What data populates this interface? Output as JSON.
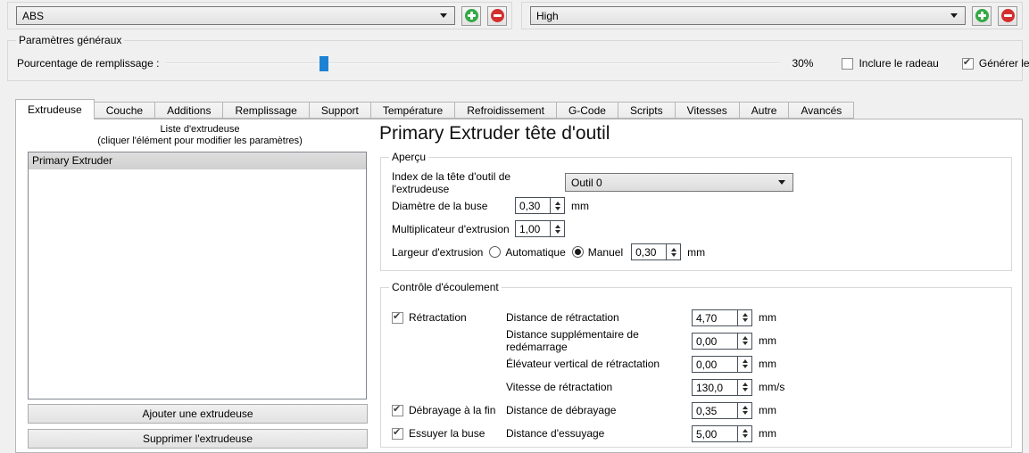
{
  "colors": {
    "window_background": "#f0f0f0",
    "slider_thumb_blue": "#1e82d2",
    "add_green": "#35a945",
    "remove_red": "#d32f2f"
  },
  "profiles": {
    "material_value": "ABS",
    "quality_value": "High"
  },
  "general": {
    "title": "Paramètres généraux",
    "infill_label": "Pourcentage de remplissage :",
    "infill_value": "30%",
    "infill_percent": 30,
    "raft_label": "Inclure le radeau",
    "raft_checked": false,
    "support_label": "Générer le support",
    "support_checked": true
  },
  "tabs": [
    {
      "label": "Extrudeuse",
      "active": true
    },
    {
      "label": "Couche",
      "active": false
    },
    {
      "label": "Additions",
      "active": false
    },
    {
      "label": "Remplissage",
      "active": false
    },
    {
      "label": "Support",
      "active": false
    },
    {
      "label": "Température",
      "active": false
    },
    {
      "label": "Refroidissement",
      "active": false
    },
    {
      "label": "G-Code",
      "active": false
    },
    {
      "label": "Scripts",
      "active": false
    },
    {
      "label": "Vitesses",
      "active": false
    },
    {
      "label": "Autre",
      "active": false
    },
    {
      "label": "Avancés",
      "active": false
    }
  ],
  "extruder_list": {
    "title": "Liste d'extrudeuse",
    "subtitle": "(cliquer l'élément pour modifier les paramètres)",
    "items": [
      {
        "label": "Primary Extruder",
        "selected": true
      }
    ],
    "add_button": "Ajouter une extrudeuse",
    "remove_button": "Supprimer l'extrudeuse"
  },
  "detail": {
    "title": "Primary Extruder tête d'outil",
    "overview": {
      "title": "Aperçu",
      "toolhead_label": "Index de la tête d'outil de l'extrudeuse",
      "toolhead_value": "Outil 0",
      "nozzle_label": "Diamètre de la buse",
      "nozzle_value": "0,30",
      "nozzle_unit": "mm",
      "multiplier_label": "Multiplicateur d'extrusion",
      "multiplier_value": "1,00",
      "width_label": "Largeur d'extrusion",
      "width_auto_label": "Automatique",
      "width_manual_label": "Manuel",
      "width_mode": "manual",
      "width_value": "0,30",
      "width_unit": "mm"
    },
    "ooze": {
      "title": "Contrôle d'écoulement",
      "rows": [
        {
          "checkbox": "Rétractation",
          "checked": true,
          "label": "Distance de rétractation",
          "value": "4,70",
          "unit": "mm"
        },
        {
          "checkbox": "",
          "label": "Distance supplémentaire de redémarrage",
          "value": "0,00",
          "unit": "mm"
        },
        {
          "checkbox": "",
          "label": "Élévateur vertical de rétractation",
          "value": "0,00",
          "unit": "mm"
        },
        {
          "checkbox": "",
          "label": "Vitesse de rétractation",
          "value": "130,0",
          "unit": "mm/s"
        },
        {
          "checkbox": "Débrayage à la fin",
          "checked": true,
          "label": "Distance de débrayage",
          "value": "0,35",
          "unit": "mm"
        },
        {
          "checkbox": "Essuyer la buse",
          "checked": true,
          "label": "Distance d'essuyage",
          "value": "5,00",
          "unit": "mm"
        }
      ]
    }
  }
}
